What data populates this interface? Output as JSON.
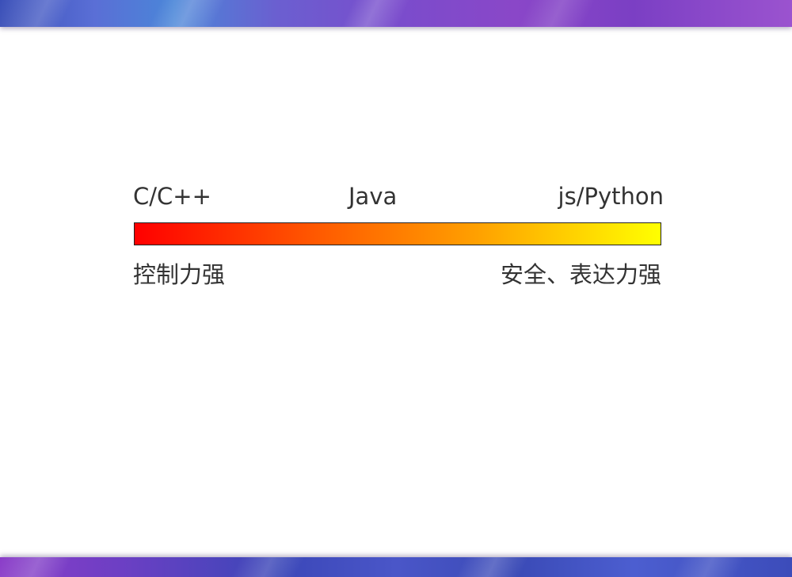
{
  "slide": {
    "languages": {
      "left": "C/C++",
      "middle": "Java",
      "right": "js/Python"
    },
    "scale": {
      "left_description": "控制力强",
      "right_description": "安全、表达力强",
      "gradient_start_color": "#ff0000",
      "gradient_end_color": "#ffff00"
    }
  }
}
